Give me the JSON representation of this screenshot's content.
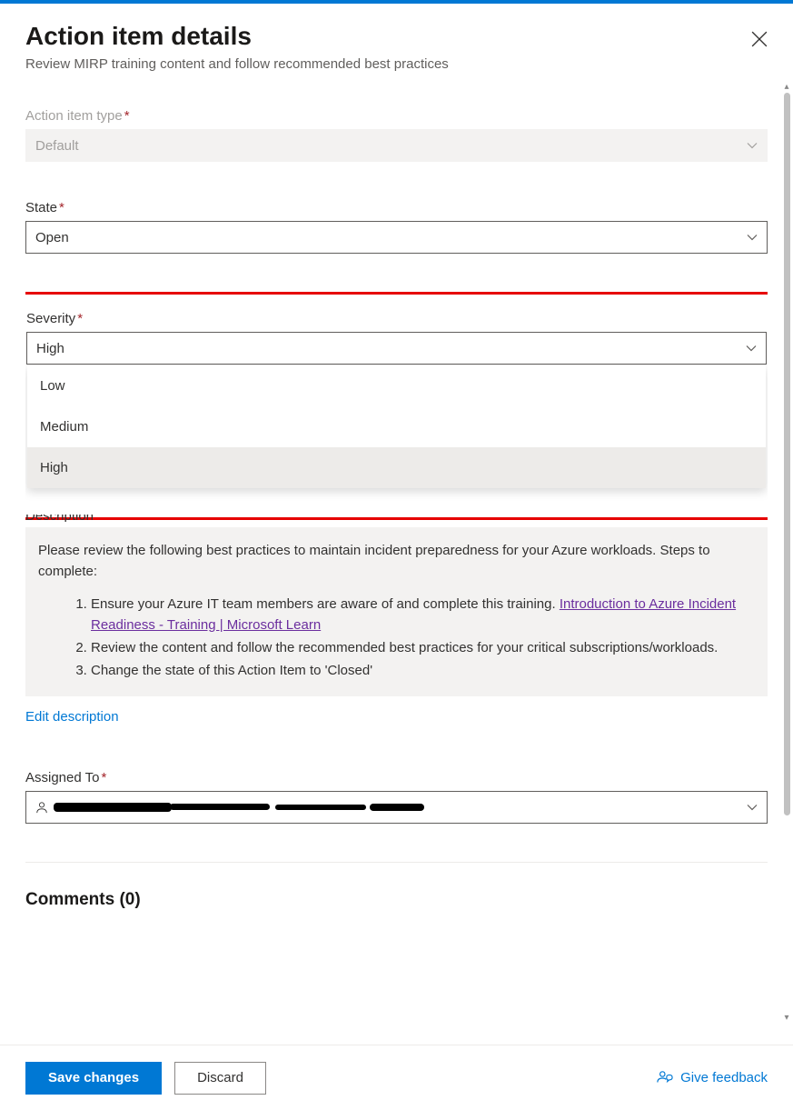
{
  "header": {
    "title": "Action item details",
    "subtitle": "Review MIRP training content and follow recommended best practices"
  },
  "fields": {
    "action_item_type": {
      "label": "Action item type",
      "value": "Default"
    },
    "state": {
      "label": "State",
      "value": "Open"
    },
    "severity": {
      "label": "Severity",
      "value": "High",
      "options": [
        "Low",
        "Medium",
        "High"
      ]
    },
    "description": {
      "label_partial": "Description",
      "intro": "Please review the following best practices to maintain incident preparedness for your Azure workloads. Steps to complete:",
      "step1": "Ensure your Azure IT team members are aware of and complete this training. ",
      "link_text": "Introduction to Azure Incident Readiness - Training | Microsoft Learn",
      "step2": "Review the content and follow the recommended best practices for your critical subscriptions/workloads.",
      "step3": "Change the state of this Action Item to 'Closed'"
    },
    "edit_description": "Edit description",
    "assigned_to": {
      "label": "Assigned To"
    }
  },
  "comments": {
    "heading": "Comments (0)"
  },
  "footer": {
    "save": "Save changes",
    "discard": "Discard",
    "feedback": "Give feedback"
  }
}
